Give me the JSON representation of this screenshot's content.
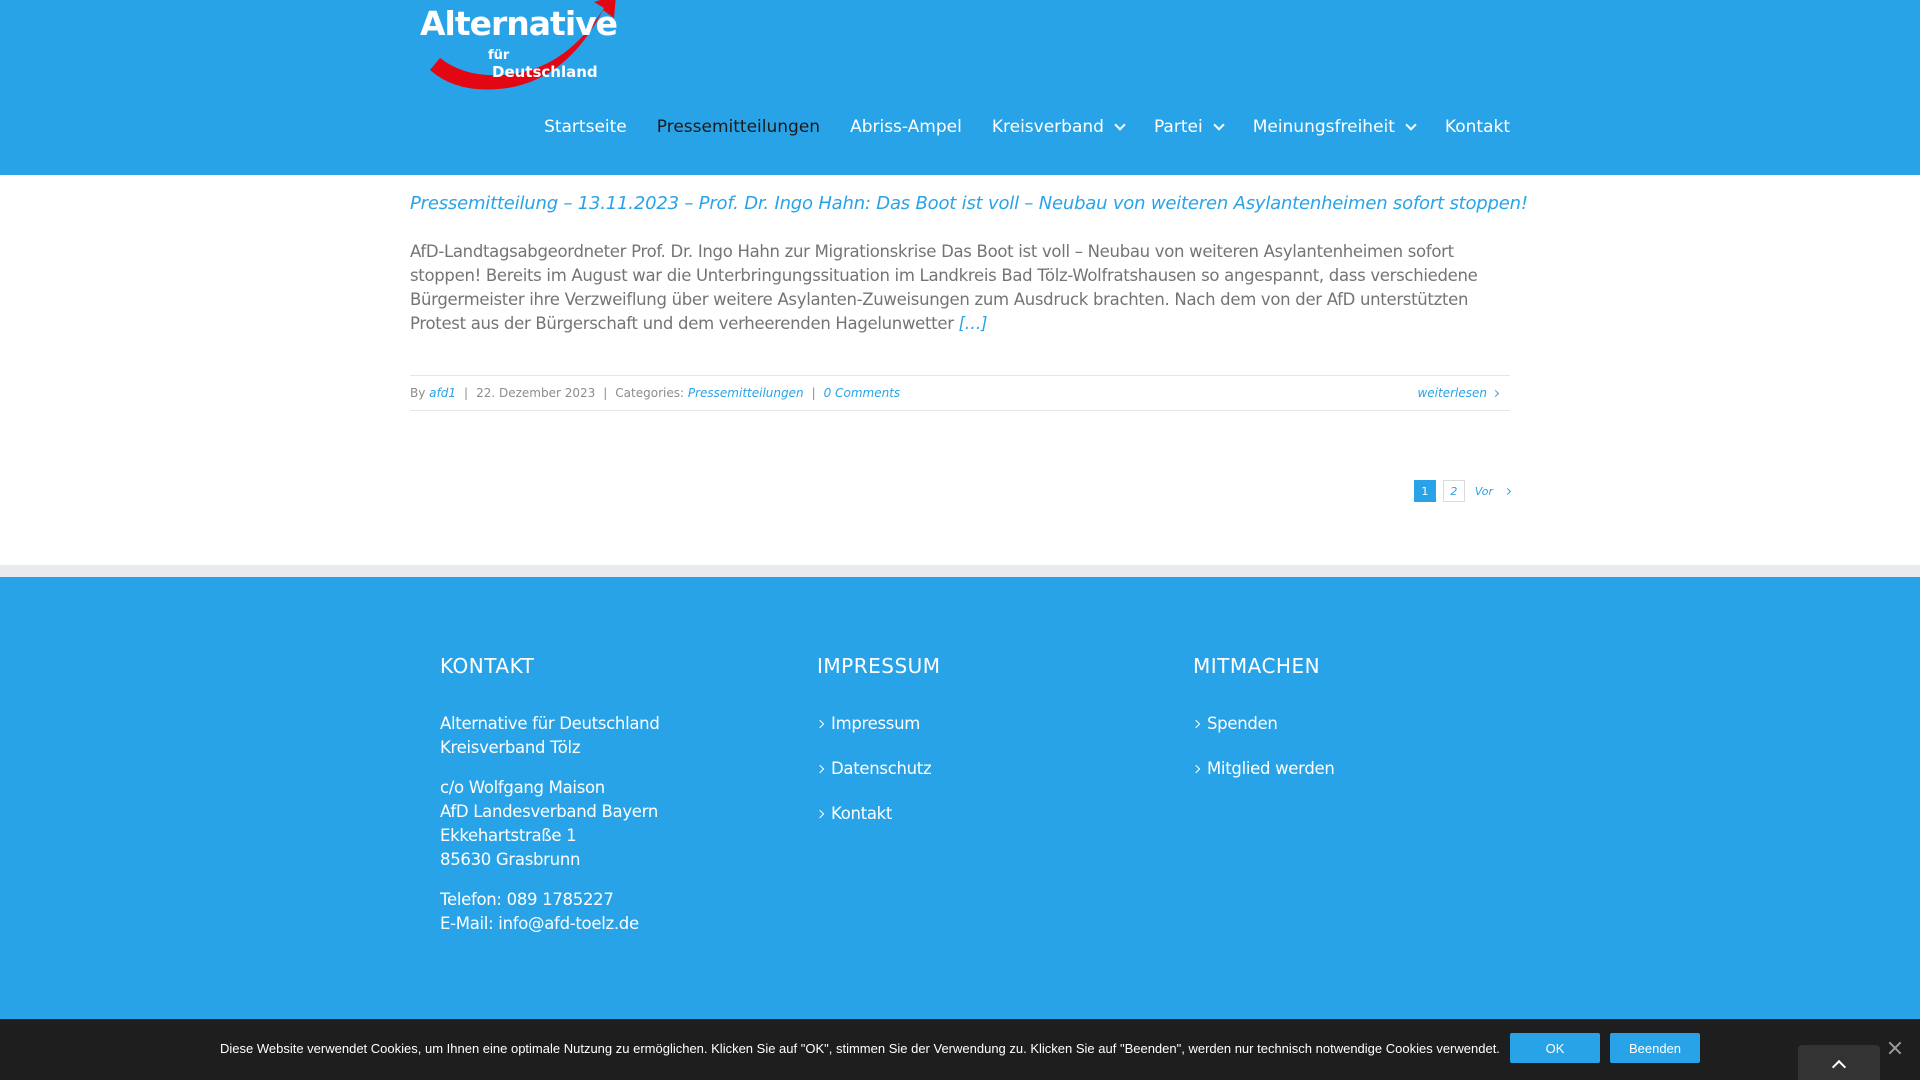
{
  "brand": {
    "logo_line1": "Alternative",
    "logo_line2": "für",
    "logo_line3": "Deutschland",
    "accent_color": "#29a3e8",
    "logo_red": "#e30613"
  },
  "nav": {
    "items": [
      {
        "label": "Startseite",
        "active": false,
        "has_dropdown": false
      },
      {
        "label": "Pressemitteilungen",
        "active": true,
        "has_dropdown": false
      },
      {
        "label": "Abriss-Ampel",
        "active": false,
        "has_dropdown": false
      },
      {
        "label": "Kreisverband",
        "active": false,
        "has_dropdown": true
      },
      {
        "label": "Partei",
        "active": false,
        "has_dropdown": true
      },
      {
        "label": "Meinungsfreiheit",
        "active": false,
        "has_dropdown": true
      },
      {
        "label": "Kontakt",
        "active": false,
        "has_dropdown": false
      }
    ]
  },
  "post": {
    "title": "Pressemitteilung – 13.11.2023 – Prof. Dr. Ingo Hahn: Das Boot ist voll – Neubau von weiteren Asylantenheimen sofort stoppen!",
    "excerpt": "AfD-Landtagsabgeordneter Prof. Dr. Ingo Hahn zur Migrationskrise Das Boot ist voll – Neubau von weiteren Asylantenheimen sofort stoppen! Bereits im August war die Unterbringungssituation im Landkreis Bad Tölz-Wolfratshausen so angespannt, dass verschiedene Bürgermeister ihre Verzweiflung über weitere Asylanten-Zuweisungen zum Ausdruck brachten. Nach dem von der AfD unterstützten Protest aus der Bürgerschaft und dem verheerenden Hagelunwetter",
    "excerpt_more": "[…]",
    "meta": {
      "by_label": "By",
      "author": "afd1",
      "date": "22. Dezember 2023",
      "categories_label": "Categories:",
      "category": "Pressemitteilungen",
      "comments": "0 Comments",
      "read_more": "weiterlesen"
    }
  },
  "pagination": {
    "pages": [
      "1",
      "2"
    ],
    "current": "1",
    "next_label": "Vor"
  },
  "footer": {
    "contact": {
      "heading": "KONTAKT",
      "org_line1": "Alternative für Deutschland",
      "org_line2": "Kreisverband Tölz",
      "addr_line1": "c/o Wolfgang Maison",
      "addr_line2": "AfD Landesverband Bayern",
      "addr_line3": "Ekkehartstraße 1",
      "addr_line4": "85630 Grasbrunn",
      "phone": "Telefon: 089 1785227",
      "email": "E-Mail: info@afd-toelz.de"
    },
    "impressum": {
      "heading": "IMPRESSUM",
      "links": [
        "Impressum",
        "Datenschutz",
        "Kontakt"
      ]
    },
    "mitmachen": {
      "heading": "MITMACHEN",
      "links": [
        "Spenden",
        "Mitglied werden"
      ]
    }
  },
  "cookie": {
    "text": "Diese Website verwendet Cookies, um Ihnen eine optimale Nutzung zu ermöglichen. Klicken Sie auf \"OK\", stimmen Sie der Verwendung zu. Klicken Sie auf \"Beenden\", werden nur technisch notwendige Cookies verwendet.",
    "ok_label": "OK",
    "end_label": "Beenden"
  }
}
